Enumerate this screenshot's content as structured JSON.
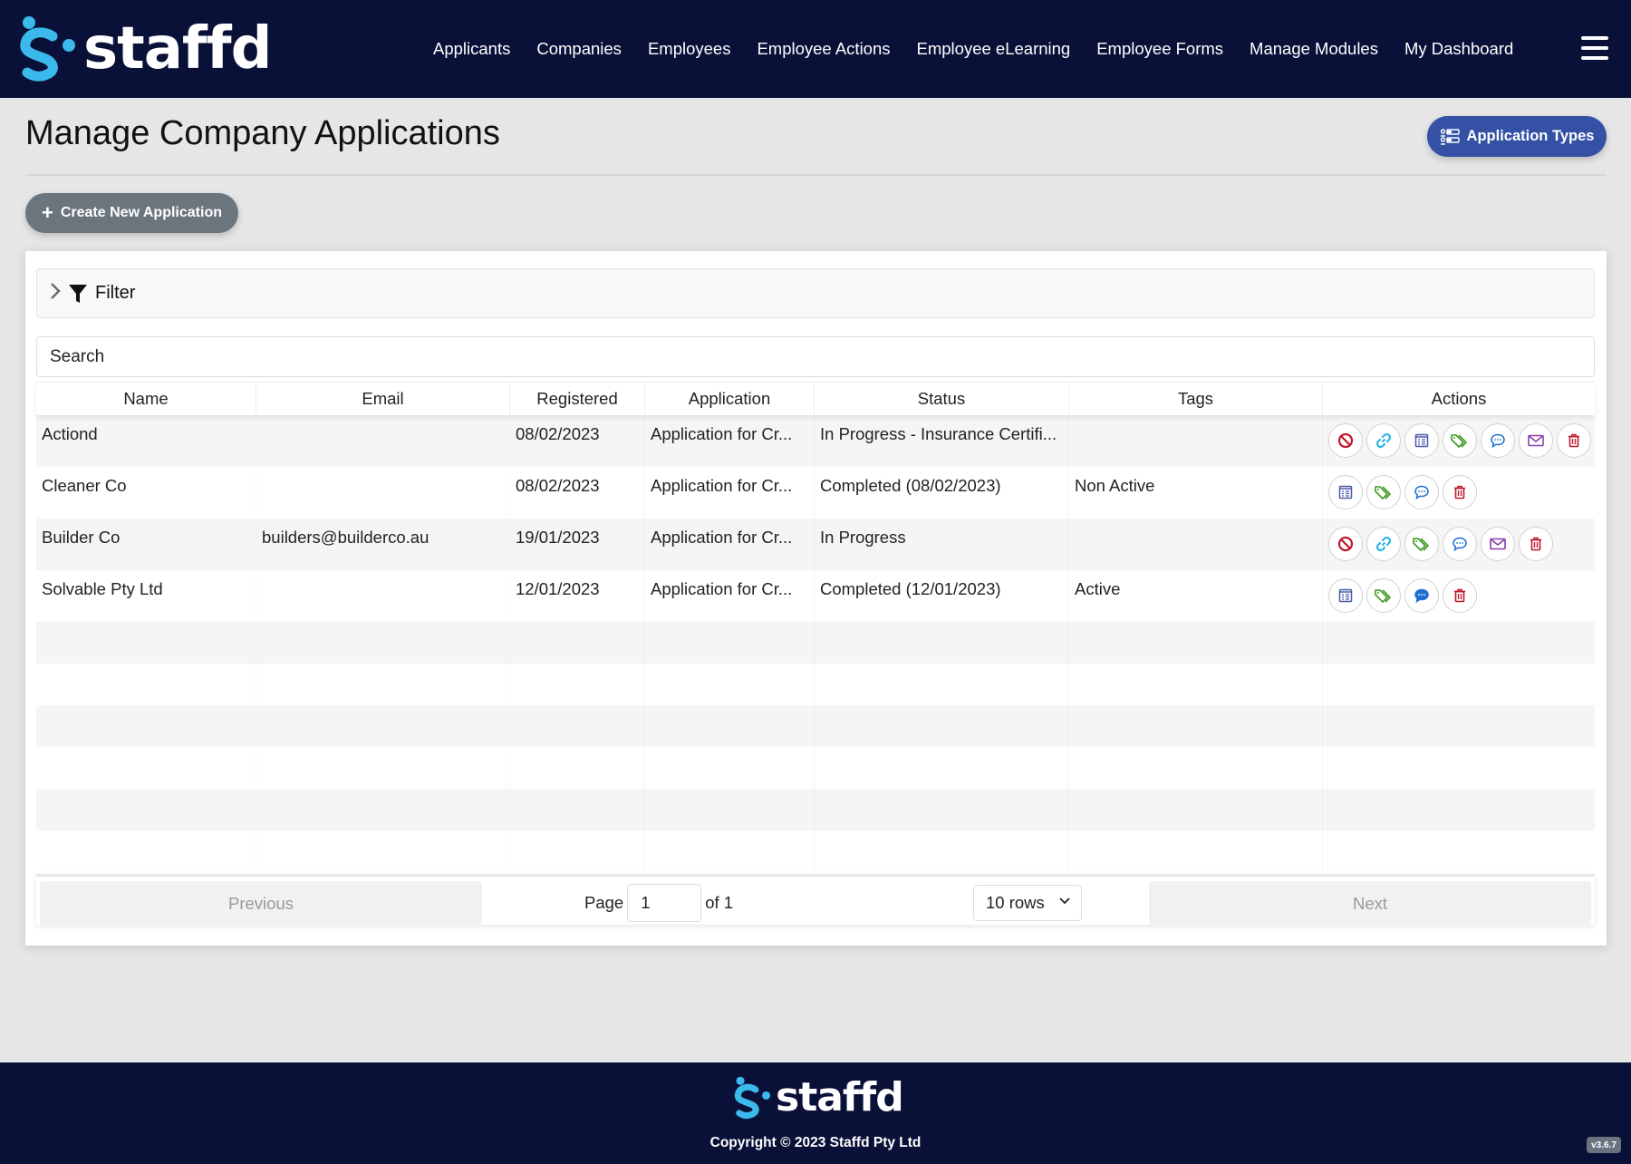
{
  "brand": {
    "name": "staffd",
    "primary_color": "#0a1138",
    "accent_color": "#3bb9ec"
  },
  "nav": {
    "items": [
      {
        "label": "Applicants"
      },
      {
        "label": "Companies"
      },
      {
        "label": "Employees"
      },
      {
        "label": "Employee Actions"
      },
      {
        "label": "Employee eLearning"
      },
      {
        "label": "Employee Forms"
      },
      {
        "label": "Manage Modules"
      },
      {
        "label": "My Dashboard"
      }
    ],
    "menu_icon": "hamburger-icon"
  },
  "page": {
    "title": "Manage Company Applications",
    "application_types_label": "Application Types",
    "create_label": "Create New Application"
  },
  "filter": {
    "label": "Filter",
    "expanded": false
  },
  "search": {
    "placeholder": "Search",
    "value": ""
  },
  "table": {
    "columns": [
      "Name",
      "Email",
      "Registered",
      "Application",
      "Status",
      "Tags",
      "Actions"
    ],
    "rows": [
      {
        "name": "Actiond",
        "email": "",
        "registered": "08/02/2023",
        "application": "Application for Cr...",
        "status": "In Progress - Insurance Certifi...",
        "tags": "",
        "actions": [
          "block",
          "link",
          "form",
          "tag",
          "comment",
          "email",
          "delete"
        ]
      },
      {
        "name": "Cleaner Co",
        "email": "",
        "registered": "08/02/2023",
        "application": "Application for Cr...",
        "status": "Completed (08/02/2023)",
        "tags": "Non Active",
        "actions": [
          "form",
          "tag",
          "comment",
          "delete"
        ]
      },
      {
        "name": "Builder Co",
        "email": "builders@builderco.au",
        "registered": "19/01/2023",
        "application": "Application for Cr...",
        "status": "In Progress",
        "tags": "",
        "actions": [
          "block",
          "link",
          "tag",
          "comment",
          "email",
          "delete"
        ]
      },
      {
        "name": "Solvable Pty Ltd",
        "email": "",
        "registered": "12/01/2023",
        "application": "Application for Cr...",
        "status": "Completed (12/01/2023)",
        "tags": "Active",
        "actions": [
          "form",
          "tag",
          "comment-filled",
          "delete"
        ]
      }
    ],
    "empty_rows": 6
  },
  "pagination": {
    "previous_label": "Previous",
    "next_label": "Next",
    "page_label": "Page",
    "current_page": "1",
    "of_label": "of 1",
    "rows_option": "10 rows"
  },
  "footer": {
    "copyright": "Copyright © 2023 Staffd Pty Ltd",
    "version": "v3.6.7"
  },
  "action_colors": {
    "block": "#c0182b",
    "link": "#2fb3e8",
    "form": "#4a5aa8",
    "tag": "#3c9a1f",
    "comment": "#1e6fd0",
    "email": "#8a3fb0",
    "delete": "#c0182b"
  }
}
